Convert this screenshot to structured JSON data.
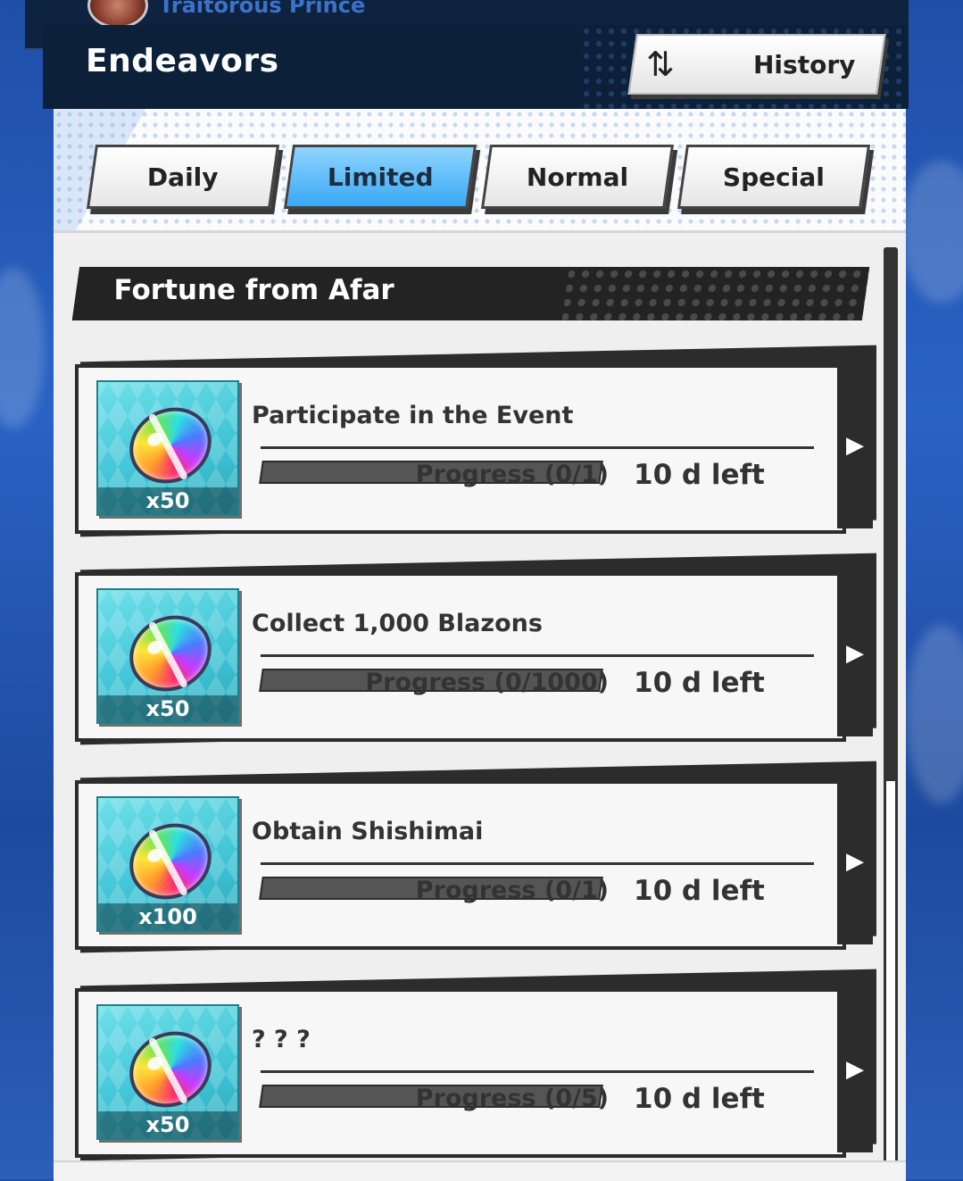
{
  "top": {
    "player_name": "Traitorous Prince"
  },
  "header": {
    "title": "Endeavors",
    "history_label": "History",
    "history_icon": "swap-arrows-icon"
  },
  "tabs": [
    {
      "label": "Daily",
      "active": false
    },
    {
      "label": "Limited",
      "active": true
    },
    {
      "label": "Normal",
      "active": false
    },
    {
      "label": "Special",
      "active": false
    }
  ],
  "section": {
    "title": "Fortune from Afar"
  },
  "tasks": [
    {
      "title": "Participate in the Event",
      "reward_icon": "rainbow-gem-icon",
      "reward_qty": "x50",
      "progress_text": "Progress (0/1)",
      "progress": 0,
      "time_left": "10 d left"
    },
    {
      "title": "Collect 1,000 Blazons",
      "reward_icon": "rainbow-gem-icon",
      "reward_qty": "x50",
      "progress_text": "Progress (0/1000)",
      "progress": 0,
      "time_left": "10 d left"
    },
    {
      "title": "Obtain Shishimai",
      "reward_icon": "rainbow-gem-icon",
      "reward_qty": "x100",
      "progress_text": "Progress (0/1)",
      "progress": 0,
      "time_left": "10 d left"
    },
    {
      "title": "? ? ?",
      "reward_icon": "rainbow-gem-icon",
      "reward_qty": "x50",
      "progress_text": "Progress (0/5)",
      "progress": 0,
      "time_left": "10 d left"
    }
  ],
  "colors": {
    "active_tab": "#3aa9f4",
    "reward_bg": "#3fc3d4",
    "panel_dark": "#2c2c2c"
  }
}
